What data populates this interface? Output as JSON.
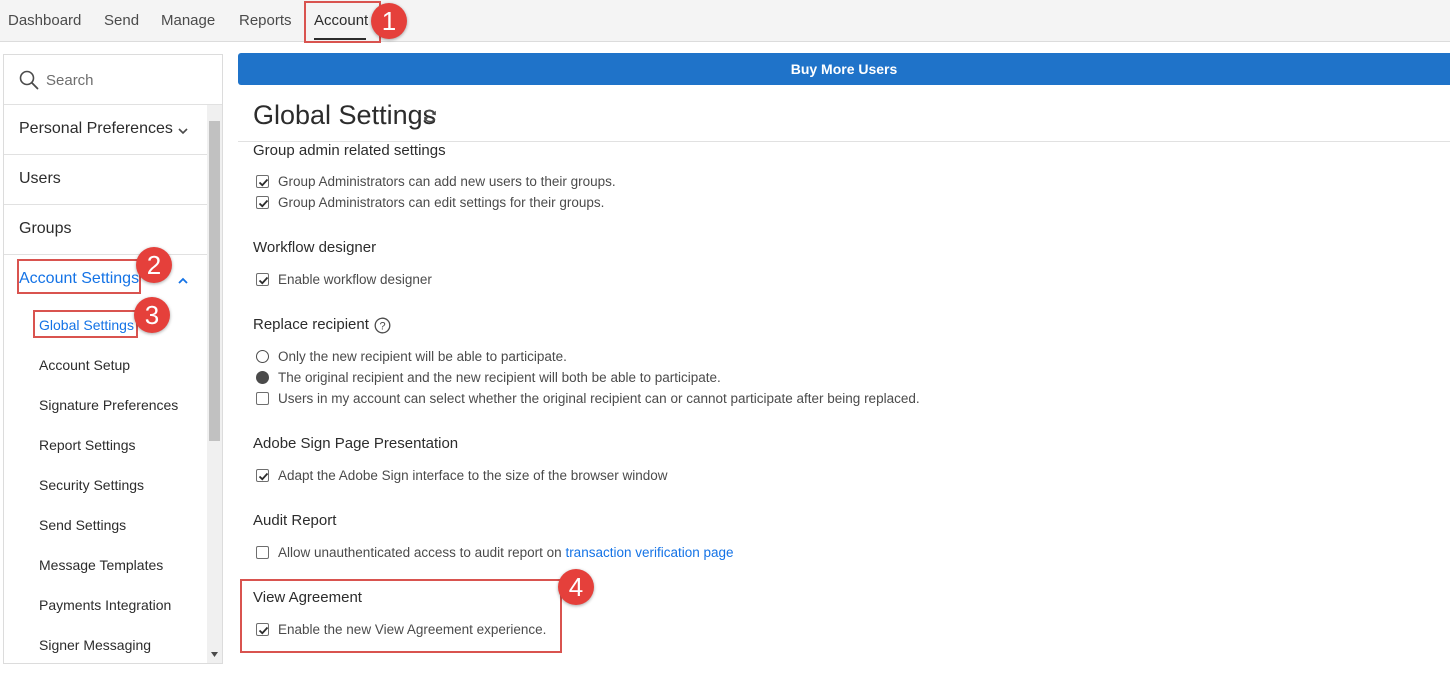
{
  "topnav": {
    "tabs": [
      {
        "label": "Dashboard"
      },
      {
        "label": "Send"
      },
      {
        "label": "Manage"
      },
      {
        "label": "Reports"
      },
      {
        "label": "Account"
      }
    ],
    "active_tab": "Account"
  },
  "annotations": [
    "1",
    "2",
    "3",
    "4"
  ],
  "sidebar": {
    "search_placeholder": "Search",
    "items": [
      {
        "label": "Personal Preferences"
      },
      {
        "label": "Users"
      },
      {
        "label": "Groups"
      },
      {
        "label": "Account Settings"
      }
    ],
    "sub_items": [
      {
        "label": "Global Settings"
      },
      {
        "label": "Account Setup"
      },
      {
        "label": "Signature Preferences"
      },
      {
        "label": "Report Settings"
      },
      {
        "label": "Security Settings"
      },
      {
        "label": "Send Settings"
      },
      {
        "label": "Message Templates"
      },
      {
        "label": "Payments Integration"
      },
      {
        "label": "Signer Messaging"
      }
    ]
  },
  "main": {
    "buy_button": "Buy More Users",
    "title": "Global Settings",
    "sections": [
      {
        "heading": "Group admin related settings",
        "options": [
          {
            "text": "Group Administrators can add new users to their groups.",
            "type": "checkbox",
            "checked": true
          },
          {
            "text": "Group Administrators can edit settings for their groups.",
            "type": "checkbox",
            "checked": true
          }
        ]
      },
      {
        "heading": "Workflow designer",
        "options": [
          {
            "text": "Enable workflow designer",
            "type": "checkbox",
            "checked": true
          }
        ]
      },
      {
        "heading": "Replace recipient",
        "options": [
          {
            "text": "Only the new recipient will be able to participate.",
            "type": "radio",
            "checked": false
          },
          {
            "text": "The original recipient and the new recipient will both be able to participate.",
            "type": "radio",
            "checked": true
          },
          {
            "text": "Users in my account can select whether the original recipient can or cannot participate after being replaced.",
            "type": "checkbox",
            "checked": false
          }
        ]
      },
      {
        "heading": "Adobe Sign Page Presentation",
        "options": [
          {
            "text": "Adapt the Adobe Sign interface to the size of the browser window",
            "type": "checkbox",
            "checked": true
          }
        ]
      },
      {
        "heading": "Audit Report",
        "options": [
          {
            "text": "Allow unauthenticated access to audit report on ",
            "link": "transaction verification page",
            "type": "checkbox",
            "checked": false
          }
        ]
      },
      {
        "heading": "View Agreement",
        "options": [
          {
            "text": "Enable the new View Agreement experience.",
            "type": "checkbox",
            "checked": true
          }
        ]
      }
    ]
  },
  "colors": {
    "accent": "#1473e6",
    "buy_bar": "#1f73c9",
    "annotation": "#e5403b"
  }
}
